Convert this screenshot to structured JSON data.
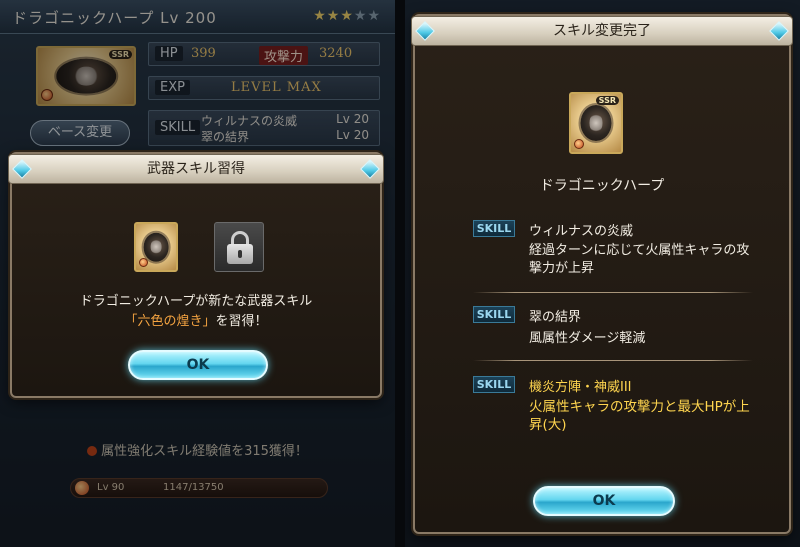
{
  "weapon_screen": {
    "title": "ドラゴニックハープ Lv 200",
    "stars_filled": 3,
    "stars_total": 5,
    "hp_label": "HP",
    "hp_value": "399",
    "atk_label": "攻撃力",
    "atk_value": "3240",
    "exp_label": "EXP",
    "exp_value": "LEVEL MAX",
    "skill_label": "SKILL",
    "skill1_name": "ウィルナスの炎威",
    "skill1_level": "Lv 20",
    "skill2_name": "翠の結界",
    "skill2_level": "Lv 20",
    "base_change_button": "ベース変更",
    "attribute_xp_note": "属性強化スキル経験値を315獲得！",
    "xp_bar_level": "Lv 90",
    "xp_bar_value": "1147/13750",
    "xp_bar_fraction": 0.083
  },
  "acquire_dialog": {
    "title": "武器スキル習得",
    "message_line1": "ドラゴニックハープが新たな武器スキル",
    "skill_name_quoted": "「六色の煌き」",
    "message_line2_suffix": "を習得！",
    "ok_label": "OK"
  },
  "complete_dialog": {
    "title": "スキル変更完了",
    "weapon_name": "ドラゴニックハープ",
    "ok_label": "OK",
    "skills": [
      {
        "tag": "SKILL",
        "name": "ウィルナスの炎威",
        "desc": "経過ターンに応じて火属性キャラの攻撃力が上昇"
      },
      {
        "tag": "SKILL",
        "name": "翠の結界",
        "desc": "風属性ダメージ軽減"
      },
      {
        "tag": "SKILL",
        "name": "機炎方陣・神威III",
        "desc": "火属性キャラの攻撃力と最大HPが上昇(大)"
      }
    ]
  },
  "colors": {
    "accent_cyan": "#63d6ef",
    "highlight_orange": "#f5a441",
    "highlight_yellow": "#ffd54f",
    "frame_gold": "#8a7a66"
  }
}
